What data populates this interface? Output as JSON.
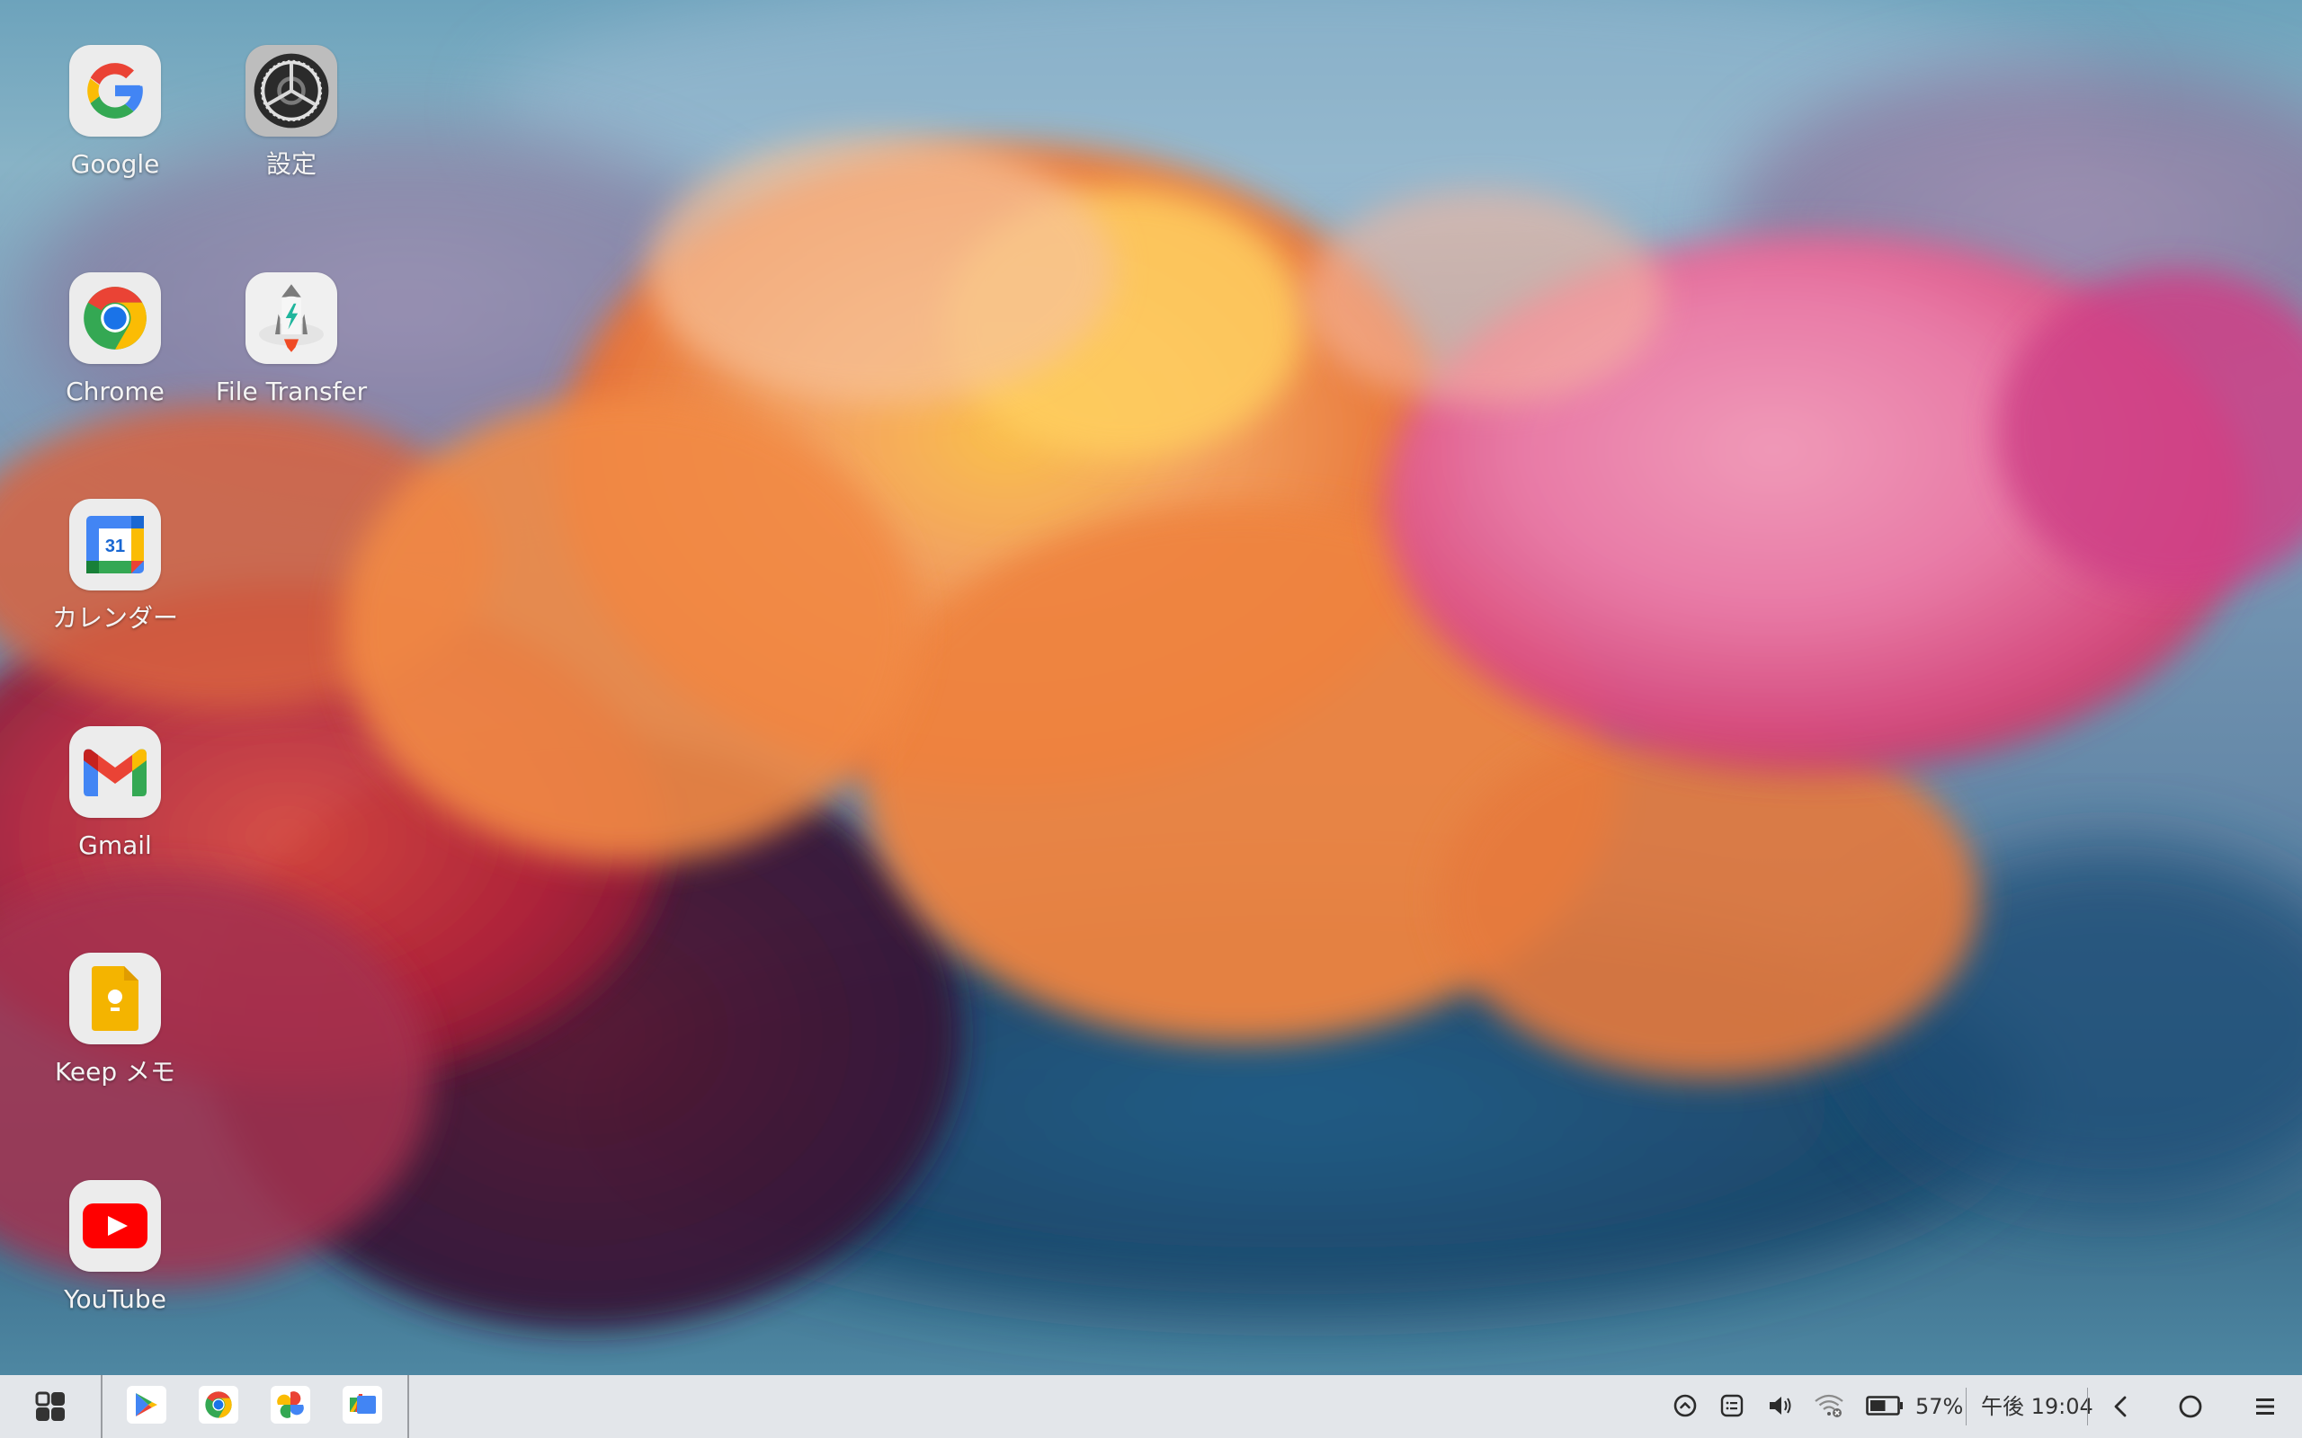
{
  "desktop": {
    "icons": [
      {
        "label": "Google",
        "icon": "google-g-icon"
      },
      {
        "label": "設定",
        "icon": "settings-gear-icon"
      },
      {
        "label": "Chrome",
        "icon": "chrome-icon"
      },
      {
        "label": "File Transfer",
        "icon": "rocket-icon"
      },
      {
        "label": "カレンダー",
        "icon": "calendar-icon",
        "day": "31"
      },
      {
        "label": "Gmail",
        "icon": "gmail-icon"
      },
      {
        "label": "Keep メモ",
        "icon": "keep-icon"
      },
      {
        "label": "YouTube",
        "icon": "youtube-icon"
      }
    ]
  },
  "taskbar": {
    "launcher": {
      "icon": "app-grid-icon"
    },
    "pinned_apps": [
      {
        "name": "Play Store",
        "icon": "play-store-icon"
      },
      {
        "name": "Chrome",
        "icon": "chrome-icon"
      },
      {
        "name": "Photos",
        "icon": "photos-pinwheel-icon"
      },
      {
        "name": "Files",
        "icon": "files-icon"
      }
    ],
    "tray": {
      "icons": [
        "expand-up-icon",
        "notes-list-icon",
        "volume-icon",
        "wifi-disconnected-icon",
        "battery-icon"
      ],
      "battery_percent": "57%",
      "battery_level": 0.57,
      "clock": "午後 19:04"
    },
    "nav": [
      "back-icon",
      "home-icon",
      "menu-icon"
    ]
  },
  "colors": {
    "taskbar_bg": "#e3e6ea",
    "icon_tile": "#ececec",
    "google_blue": "#4285f4",
    "google_red": "#ea4335",
    "google_yellow": "#fbbc04",
    "google_green": "#34a853",
    "youtube_red": "#ff0000"
  }
}
